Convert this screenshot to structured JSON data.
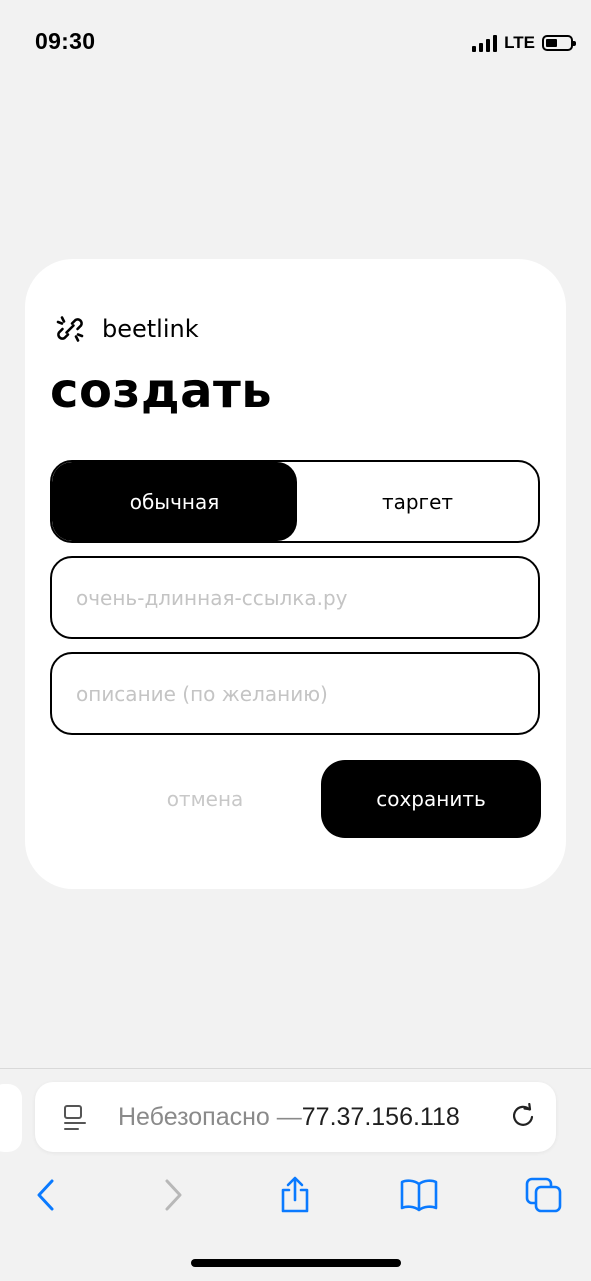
{
  "status_bar": {
    "time": "09:30",
    "network": "LTE",
    "signal_bars": 4,
    "battery_level": 0.45,
    "icons": [
      "signal-icon",
      "battery-icon"
    ]
  },
  "card": {
    "brand": {
      "name": "beetlink",
      "icon": "beetlink-logo-icon"
    },
    "title": "создать",
    "link_type": {
      "options": [
        "обычная",
        "таргет"
      ],
      "selected": "обычная"
    },
    "url_field": {
      "value": "",
      "placeholder": "очень-длинная-ссылка.ру"
    },
    "description_field": {
      "value": "",
      "placeholder": "описание (по желанию)"
    },
    "actions": {
      "cancel_label": "отмена",
      "save_label": "сохранить"
    }
  },
  "browser": {
    "url_prefix": "Небезопасно — ",
    "url_host": "77.37.156.118",
    "icons": [
      "reader-icon",
      "reload-icon"
    ],
    "toolbar": [
      "back-icon",
      "forward-icon",
      "share-icon",
      "bookmarks-icon",
      "tabs-icon"
    ]
  },
  "colors": {
    "page_background": "#f2f2f2",
    "card_background": "#ffffff",
    "accent": "#000000",
    "placeholder": "#c4c4c4",
    "link_blue": "#0a7aff",
    "disabled_gray": "#b8b8b8"
  }
}
